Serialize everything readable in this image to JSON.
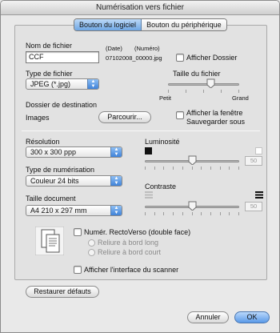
{
  "window": {
    "title": "Numérisation vers fichier"
  },
  "tabs": [
    {
      "label": "Bouton du logiciel",
      "active": true
    },
    {
      "label": "Bouton du périphérique",
      "active": false
    }
  ],
  "file": {
    "name_label": "Nom de fichier",
    "date_label": "(Date)",
    "number_label": "(Numéro)",
    "name_value": "CCF",
    "example_name": "07102008_00000.jpg",
    "show_folder_label": "Afficher Dossier"
  },
  "file_type": {
    "label": "Type de fichier",
    "value": "JPEG (*.jpg)"
  },
  "file_size": {
    "label": "Taille du fichier",
    "min_label": "Petit",
    "max_label": "Grand",
    "level": 0.6
  },
  "destination": {
    "label": "Dossier de destination",
    "value": "Images",
    "browse_label": "Parcourir...",
    "show_save_as_label_1": "Afficher la fenêtre",
    "show_save_as_label_2": "Sauvegarder sous"
  },
  "resolution": {
    "label": "Résolution",
    "value": "300 x 300 ppp"
  },
  "scan_type": {
    "label": "Type de numérisation",
    "value": "Couleur 24 bits"
  },
  "doc_size": {
    "label": "Taille document",
    "value": "A4  210 x 297 mm"
  },
  "brightness": {
    "label": "Luminosité",
    "value": "50",
    "level": 0.5
  },
  "contrast": {
    "label": "Contraste",
    "value": "50",
    "level": 0.5
  },
  "duplex": {
    "label": "Numér. RectoVerso (double face)",
    "long_edge_label": "Reliure à bord long",
    "short_edge_label": "Reliure à bord court"
  },
  "scanner_ui": {
    "label": "Afficher l'interface du scanner"
  },
  "buttons": {
    "restore_defaults": "Restaurer défauts",
    "cancel": "Annuler",
    "ok": "OK"
  },
  "colors": {
    "accent": "#5a9ae8",
    "active_tab": "#6ea6e4"
  }
}
